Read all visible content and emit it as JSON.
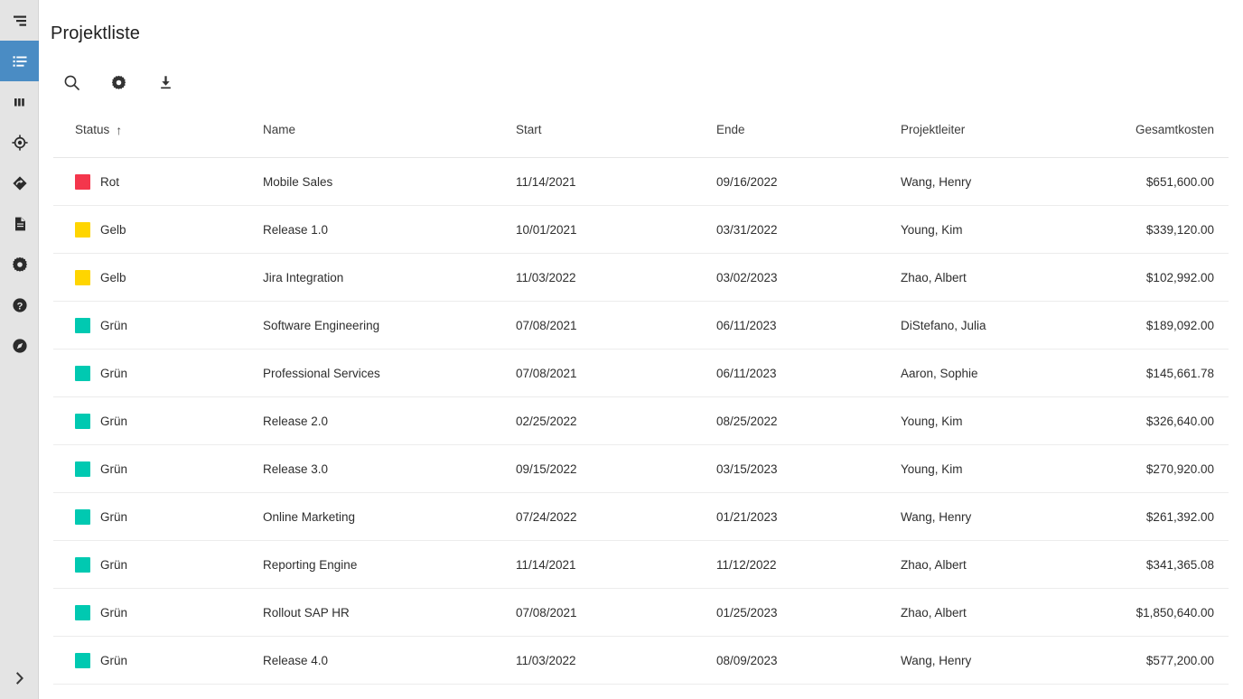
{
  "app": {
    "page_title": "Projektliste"
  },
  "sidebar": {
    "menu_toggle_label": "Menü",
    "expand_label": "Erweitern",
    "items": [
      {
        "id": "project-list",
        "icon": "list-icon",
        "label": "Projektliste",
        "active": true
      },
      {
        "id": "gantt",
        "icon": "bar-chart-icon",
        "label": "Gantt",
        "active": false
      },
      {
        "id": "target",
        "icon": "target-icon",
        "label": "Ziele",
        "active": false
      },
      {
        "id": "milestone",
        "icon": "milestone-diamond-icon",
        "label": "Meilensteine",
        "active": false
      },
      {
        "id": "documents",
        "icon": "document-icon",
        "label": "Dokumente",
        "active": false
      },
      {
        "id": "settings",
        "icon": "gear-icon",
        "label": "Einstellungen",
        "active": false
      },
      {
        "id": "help",
        "icon": "help-circle-icon",
        "label": "Hilfe",
        "active": false
      },
      {
        "id": "explore",
        "icon": "compass-icon",
        "label": "Entdecken",
        "active": false
      }
    ]
  },
  "toolbar": {
    "buttons": [
      {
        "id": "search",
        "icon": "search-icon",
        "label": "Suchen"
      },
      {
        "id": "settings",
        "icon": "gear-icon",
        "label": "Einstellungen"
      },
      {
        "id": "download",
        "icon": "download-icon",
        "label": "Herunterladen"
      }
    ]
  },
  "table": {
    "sort": {
      "column": "Status",
      "direction": "asc",
      "glyph": "↑"
    },
    "columns": [
      {
        "key": "status",
        "label": "Status",
        "align": "left",
        "sorted": true
      },
      {
        "key": "name",
        "label": "Name",
        "align": "left",
        "sorted": false
      },
      {
        "key": "start",
        "label": "Start",
        "align": "left",
        "sorted": false
      },
      {
        "key": "ende",
        "label": "Ende",
        "align": "left",
        "sorted": false
      },
      {
        "key": "leiter",
        "label": "Projektleiter",
        "align": "left",
        "sorted": false
      },
      {
        "key": "kosten",
        "label": "Gesamtkosten",
        "align": "right",
        "sorted": false
      }
    ],
    "status_colors": {
      "Rot": "#F4364C",
      "Gelb": "#FFD500",
      "Grün": "#00C9B1"
    },
    "rows": [
      {
        "status": "Rot",
        "name": "Mobile Sales",
        "start": "11/14/2021",
        "ende": "09/16/2022",
        "leiter": "Wang, Henry",
        "kosten": "$651,600.00"
      },
      {
        "status": "Gelb",
        "name": "Release 1.0",
        "start": "10/01/2021",
        "ende": "03/31/2022",
        "leiter": "Young, Kim",
        "kosten": "$339,120.00"
      },
      {
        "status": "Gelb",
        "name": "Jira Integration",
        "start": "11/03/2022",
        "ende": "03/02/2023",
        "leiter": "Zhao, Albert",
        "kosten": "$102,992.00"
      },
      {
        "status": "Grün",
        "name": "Software Engineering",
        "start": "07/08/2021",
        "ende": "06/11/2023",
        "leiter": "DiStefano, Julia",
        "kosten": "$189,092.00"
      },
      {
        "status": "Grün",
        "name": "Professional Services",
        "start": "07/08/2021",
        "ende": "06/11/2023",
        "leiter": "Aaron, Sophie",
        "kosten": "$145,661.78"
      },
      {
        "status": "Grün",
        "name": "Release 2.0",
        "start": "02/25/2022",
        "ende": "08/25/2022",
        "leiter": "Young, Kim",
        "kosten": "$326,640.00"
      },
      {
        "status": "Grün",
        "name": "Release 3.0",
        "start": "09/15/2022",
        "ende": "03/15/2023",
        "leiter": "Young, Kim",
        "kosten": "$270,920.00"
      },
      {
        "status": "Grün",
        "name": "Online Marketing",
        "start": "07/24/2022",
        "ende": "01/21/2023",
        "leiter": "Wang, Henry",
        "kosten": "$261,392.00"
      },
      {
        "status": "Grün",
        "name": "Reporting Engine",
        "start": "11/14/2021",
        "ende": "11/12/2022",
        "leiter": "Zhao, Albert",
        "kosten": "$341,365.08"
      },
      {
        "status": "Grün",
        "name": "Rollout SAP HR",
        "start": "07/08/2021",
        "ende": "01/25/2023",
        "leiter": "Zhao, Albert",
        "kosten": "$1,850,640.00"
      },
      {
        "status": "Grün",
        "name": "Release 4.0",
        "start": "11/03/2022",
        "ende": "08/09/2023",
        "leiter": "Wang, Henry",
        "kosten": "$577,200.00"
      }
    ]
  },
  "theme": {
    "accent_blue": "#4A8CC4",
    "sidebar_bg": "#E4E4E4",
    "text_primary": "#2E2E2E"
  }
}
